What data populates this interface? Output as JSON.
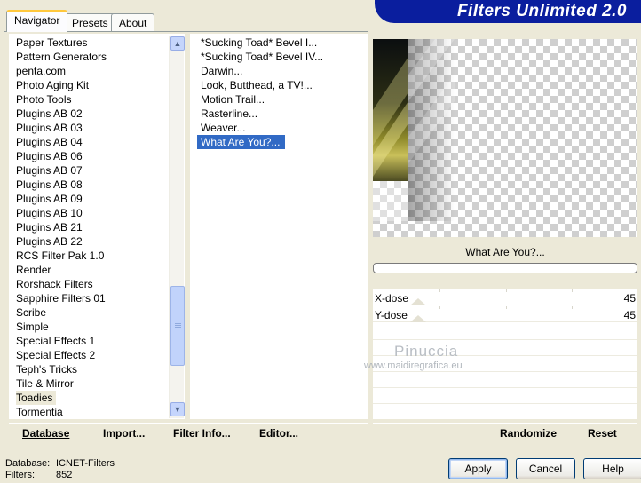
{
  "tabs": [
    {
      "label": "Navigator",
      "active": true
    },
    {
      "label": "Presets",
      "active": false
    },
    {
      "label": "About",
      "active": false
    }
  ],
  "banner": {
    "title": "Filters Unlimited 2.0"
  },
  "categories": [
    "Paper Textures",
    "Pattern Generators",
    "penta.com",
    "Photo Aging Kit",
    "Photo Tools",
    "Plugins AB 02",
    "Plugins AB 03",
    "Plugins AB 04",
    "Plugins AB 06",
    "Plugins AB 07",
    "Plugins AB 08",
    "Plugins AB 09",
    "Plugins AB 10",
    "Plugins AB 21",
    "Plugins AB 22",
    "RCS Filter Pak 1.0",
    "Render",
    "Rorshack Filters",
    "Sapphire Filters 01",
    "Scribe",
    "Simple",
    "Special Effects 1",
    "Special Effects 2",
    "Teph's Tricks",
    "Tile & Mirror",
    "Toadies",
    "Tormentia"
  ],
  "selected_category": "Toadies",
  "filters": [
    "*Sucking Toad*  Bevel I...",
    "*Sucking Toad*  Bevel IV...",
    "Darwin...",
    "Look, Butthead, a TV!...",
    "Motion Trail...",
    "Rasterline...",
    "Weaver...",
    "What Are You?..."
  ],
  "selected_filter": "What Are You?...",
  "preview": {
    "filter_name": "What Are You?..."
  },
  "params": [
    {
      "label": "X-dose",
      "value": "45"
    },
    {
      "label": "Y-dose",
      "value": "45"
    }
  ],
  "watermark": {
    "name": "Pinuccia",
    "url": "www.maidiregrafica.eu"
  },
  "left_bar": {
    "database": "Database",
    "import": "Import...",
    "filter_info": "Filter Info...",
    "editor": "Editor..."
  },
  "right_bar": {
    "randomize": "Randomize",
    "reset": "Reset"
  },
  "info": {
    "database_label": "Database:",
    "database_value": "ICNET-Filters",
    "filters_label": "Filters:",
    "filters_value": "852"
  },
  "buttons": {
    "apply": "Apply",
    "cancel": "Cancel",
    "help": "Help"
  }
}
